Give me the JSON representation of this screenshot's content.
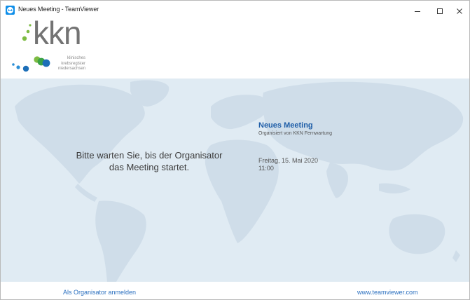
{
  "window": {
    "title": "Neues Meeting - TeamViewer",
    "icon": "teamviewer-icon",
    "controls": {
      "minimize": "minimize-icon",
      "maximize": "maximize-icon",
      "close": "close-icon"
    }
  },
  "logo": {
    "wordmark": "kkn",
    "subtitle_lines": [
      "klinisches",
      "krebsregister",
      "niedersachsen"
    ],
    "dot_colors": [
      "#2b8fd6",
      "#7dbb42",
      "#3aa346",
      "#1d6fb8"
    ]
  },
  "wait_message": {
    "line1": "Bitte warten Sie, bis der Organisator",
    "line2": "das Meeting startet."
  },
  "meeting": {
    "title": "Neues Meeting",
    "organizer": "Organisiert von KKN Fernwartung",
    "date": "Freitag, 15. Mai 2020",
    "time": "11:00"
  },
  "footer": {
    "organizer_login": "Als Organisator anmelden",
    "website": "www.teamviewer.com"
  },
  "colors": {
    "accent": "#1f5ea8",
    "link": "#2a6fbf",
    "map_background": "#e0ebf3",
    "map_land": "#cfdde9"
  }
}
